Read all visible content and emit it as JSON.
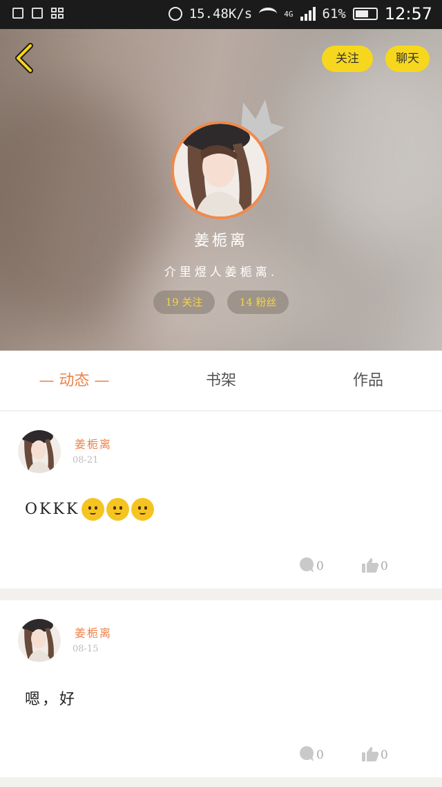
{
  "status_bar": {
    "net_speed": "15.48K/s",
    "network_type": "4G",
    "battery": "61%",
    "time": "12:57"
  },
  "profile": {
    "follow_button": "关注",
    "chat_button": "聊天",
    "name": "姜栀离",
    "bio": "介里煜人姜栀离.",
    "following_stat": "19 关注",
    "fans_stat": "14 粉丝",
    "ring_color": "#f08a4b",
    "accent_color": "#f7d71e"
  },
  "tabs": [
    {
      "label": "— 动态 —",
      "active": true
    },
    {
      "label": "书架",
      "active": false
    },
    {
      "label": "作品",
      "active": false
    }
  ],
  "posts": [
    {
      "author": "姜栀离",
      "date": "08-21",
      "text": "OKKK",
      "emoji_count": 3,
      "comments": "0",
      "likes": "0"
    },
    {
      "author": "姜栀离",
      "date": "08-15",
      "text": "嗯，好",
      "emoji_count": 0,
      "comments": "0",
      "likes": "0"
    }
  ]
}
